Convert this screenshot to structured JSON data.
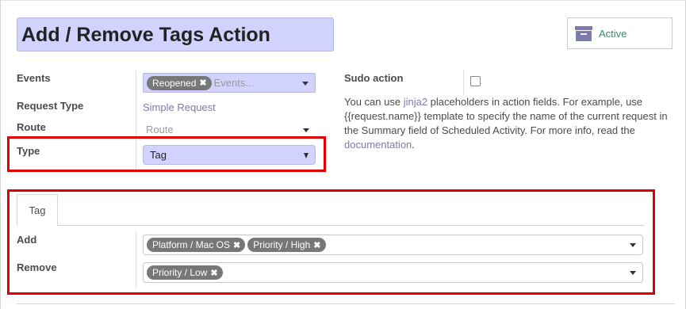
{
  "header": {
    "title": "Add / Remove Tags Action",
    "active_button": {
      "label": "Active",
      "icon": "archive-icon"
    }
  },
  "fields": {
    "events": {
      "label": "Events",
      "tags": [
        {
          "label": "Reopened"
        }
      ],
      "placeholder": "Events..."
    },
    "request_type": {
      "label": "Request Type",
      "value": "Simple Request"
    },
    "route": {
      "label": "Route",
      "placeholder": "Route"
    },
    "type": {
      "label": "Type",
      "value": "Tag"
    },
    "sudo": {
      "label": "Sudo action",
      "checked": false
    }
  },
  "help": {
    "text_1": "You can use ",
    "link_jinja": "jinja2",
    "text_2": " placeholders in action fields. For example, use {{request.name}} template to specify the name of the current request in the Summary field of Scheduled Activity. For more info, read the ",
    "link_docs": "documentation",
    "text_3": "."
  },
  "tabs": [
    {
      "label": "Tag",
      "active": true
    }
  ],
  "tag_section": {
    "add": {
      "label": "Add",
      "tags": [
        {
          "label": "Platform / Mac OS"
        },
        {
          "label": "Priority / High"
        }
      ]
    },
    "remove": {
      "label": "Remove",
      "tags": [
        {
          "label": "Priority / Low"
        }
      ]
    }
  },
  "colors": {
    "accent": "#7c7bad",
    "highlight_field": "#d2d2ff",
    "tag_bg": "#777777",
    "annotation_red": "#e00000",
    "active_text": "#3a8a73"
  }
}
